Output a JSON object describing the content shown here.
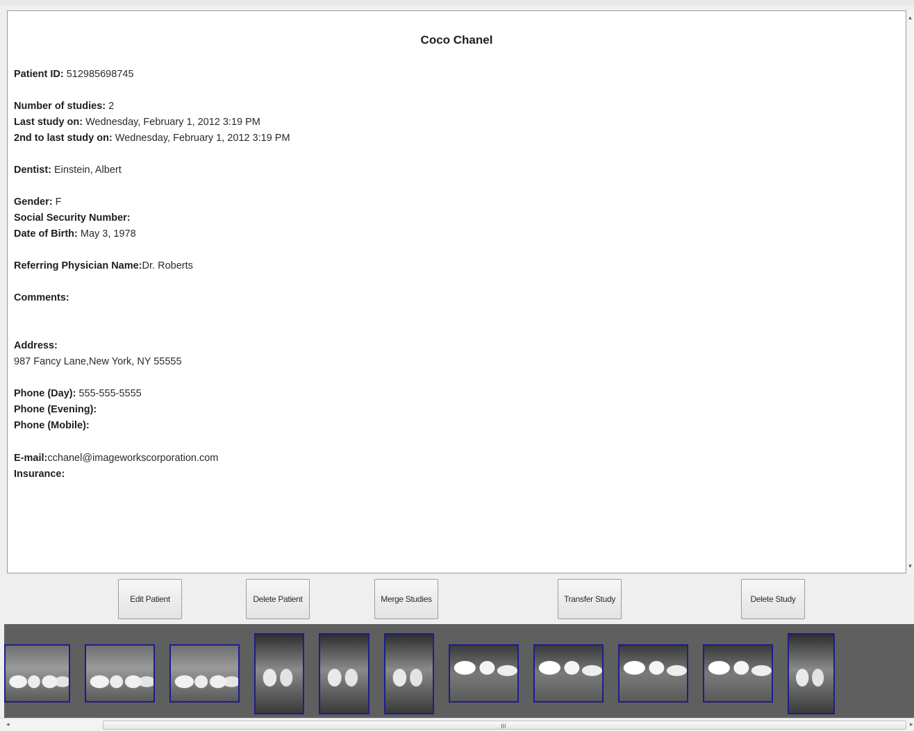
{
  "patient": {
    "name": "Coco Chanel",
    "fields": [
      {
        "label": "Patient ID:",
        "value": " 512985698745"
      },
      {
        "label": "Number of studies:",
        "value": " 2"
      },
      {
        "label": "Last study on:",
        "value": " Wednesday, February 1, 2012 3:19 PM"
      },
      {
        "label": "2nd to last study on:",
        "value": " Wednesday, February 1, 2012 3:19 PM"
      },
      {
        "label": "Dentist:",
        "value": " Einstein, Albert"
      },
      {
        "label": "Gender:",
        "value": " F"
      },
      {
        "label": "Social Security Number:",
        "value": ""
      },
      {
        "label": "Date of Birth:",
        "value": " May 3, 1978"
      },
      {
        "label": "Referring Physician Name:",
        "value": "Dr. Roberts"
      },
      {
        "label": "Comments:",
        "value": ""
      },
      {
        "label": "Address:",
        "value": ""
      },
      {
        "label": "",
        "value": "987 Fancy Lane,New York, NY 55555"
      },
      {
        "label": "Phone (Day):",
        "value": " 555-555-5555"
      },
      {
        "label": "Phone (Evening):",
        "value": ""
      },
      {
        "label": "Phone (Mobile):",
        "value": ""
      },
      {
        "label": "E-mail:",
        "value": "cchanel@imageworkscorporation.com"
      },
      {
        "label": "Insurance:",
        "value": ""
      }
    ]
  },
  "actions": {
    "edit_patient": "Edit Patient",
    "delete_patient": "Delete Patient",
    "merge_studies": "Merge Studies",
    "transfer_study": "Transfer Study",
    "delete_study": "Delete Study"
  },
  "thumbnails": [
    {
      "kind": "wide"
    },
    {
      "kind": "wide"
    },
    {
      "kind": "wide"
    },
    {
      "kind": "tall"
    },
    {
      "kind": "tall"
    },
    {
      "kind": "tall"
    },
    {
      "kind": "bite"
    },
    {
      "kind": "bite"
    },
    {
      "kind": "bite"
    },
    {
      "kind": "bite"
    },
    {
      "kind": "tall"
    }
  ],
  "scrollbar": {
    "grip_glyph": "III"
  },
  "colors": {
    "thumb_border": "#1d1d8c",
    "strip_bg": "#5f5f5f"
  }
}
